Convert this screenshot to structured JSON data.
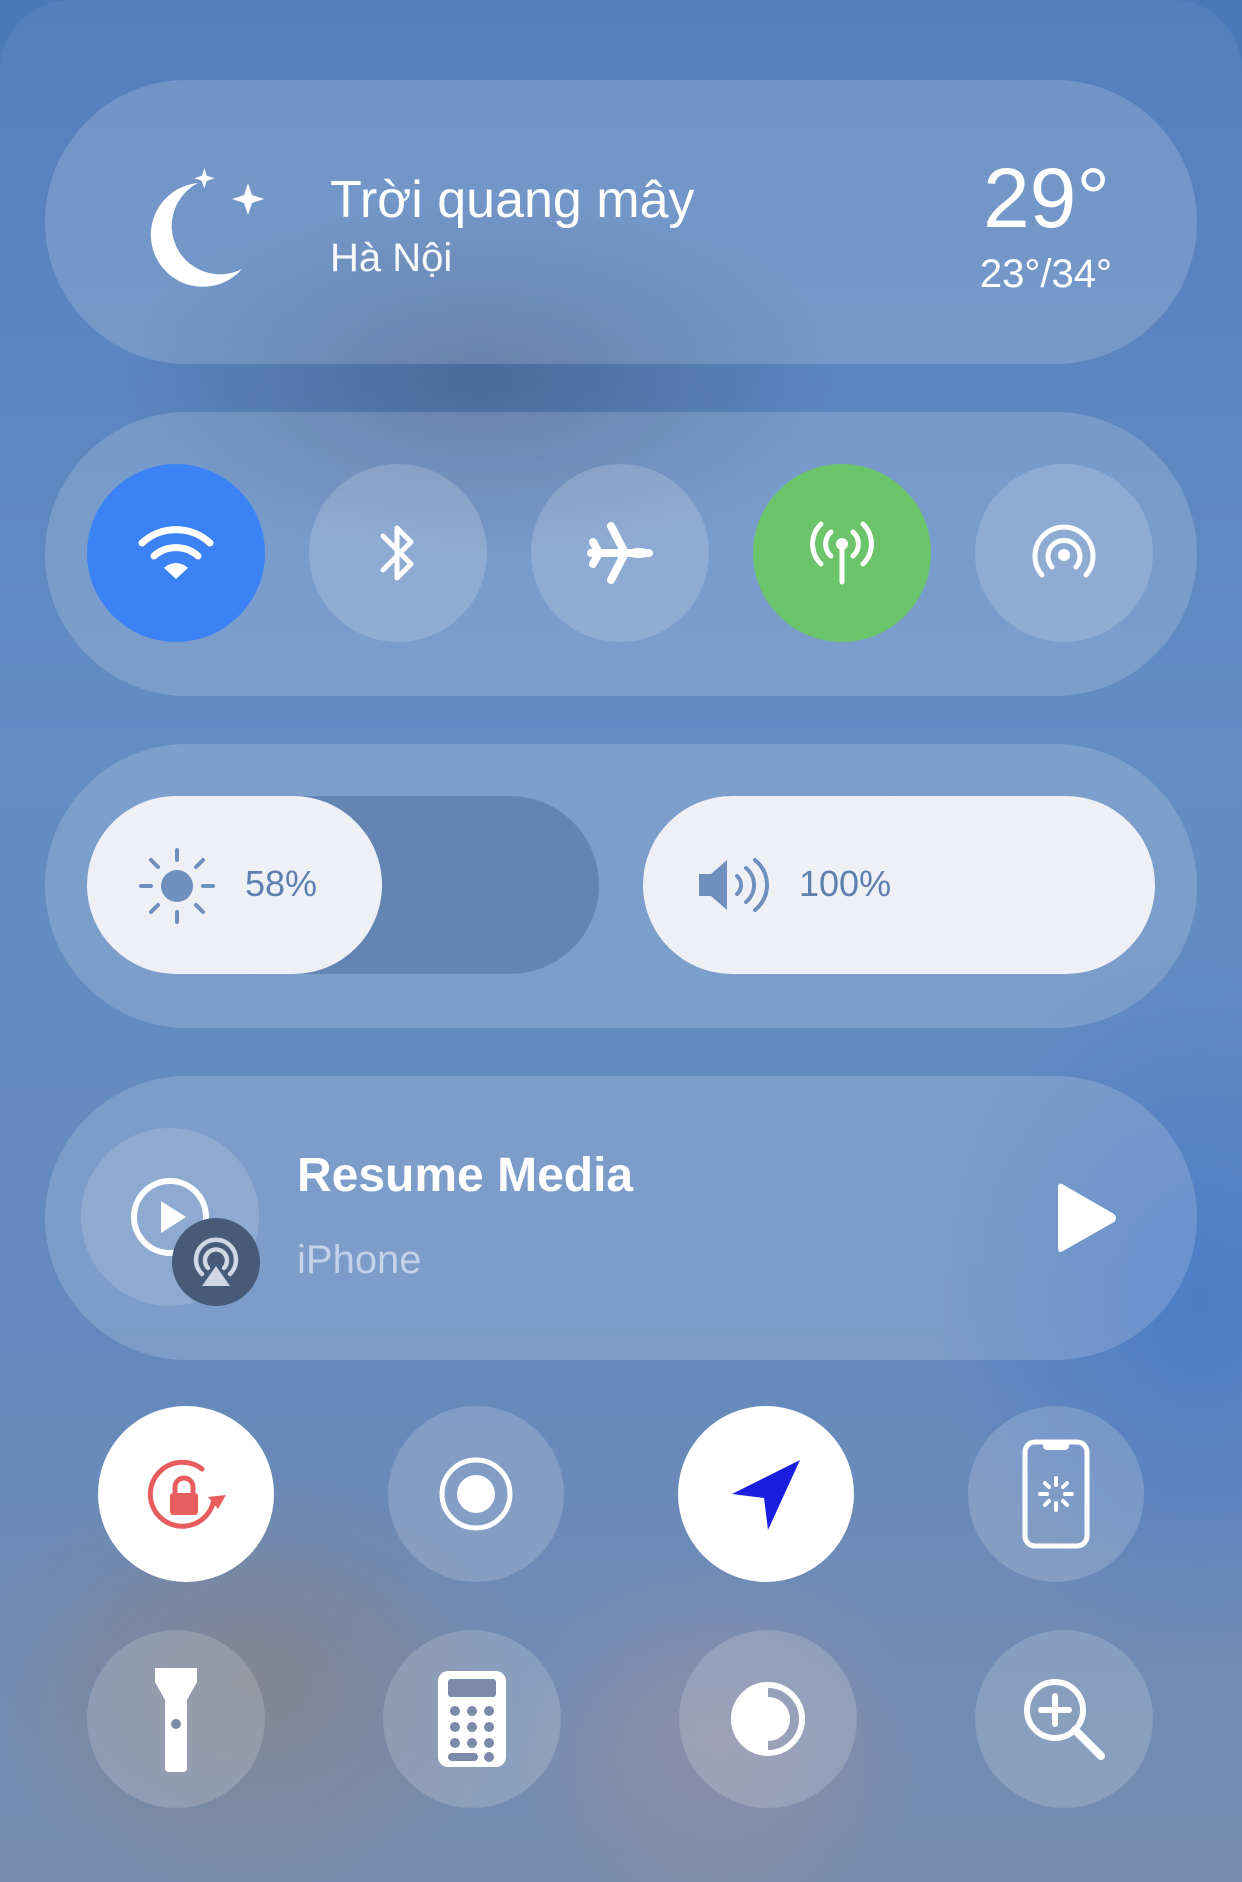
{
  "weather": {
    "condition": "Trời quang mây",
    "location": "Hà Nội",
    "temperature": "29°",
    "range": "23°/34°",
    "icon": "moon-stars-icon"
  },
  "connectivity": [
    {
      "name": "wifi",
      "icon": "wifi-icon",
      "active": true,
      "color": "#3b82f6"
    },
    {
      "name": "bluetooth",
      "icon": "bluetooth-icon",
      "active": false
    },
    {
      "name": "airplane-mode",
      "icon": "airplane-icon",
      "active": false
    },
    {
      "name": "cellular-data",
      "icon": "cellular-antenna-icon",
      "active": true,
      "color": "#6cc46a"
    },
    {
      "name": "airdrop",
      "icon": "airdrop-icon",
      "active": false
    }
  ],
  "brightness": {
    "label": "58%",
    "level": 0.58
  },
  "volume": {
    "label": "100%",
    "level": 1.0
  },
  "media": {
    "title": "Resume Media",
    "device": "iPhone"
  },
  "controls_row1": [
    {
      "name": "orientation-lock",
      "icon": "rotation-lock-icon",
      "active": true,
      "color": "#e85d5d"
    },
    {
      "name": "screen-record",
      "icon": "record-icon",
      "active": false
    },
    {
      "name": "location",
      "icon": "location-arrow-icon",
      "active": true,
      "color": "#1a1ee0"
    },
    {
      "name": "screen-mirroring",
      "icon": "phone-loading-icon",
      "active": false
    }
  ],
  "controls_row2": [
    {
      "name": "flashlight",
      "icon": "flashlight-icon"
    },
    {
      "name": "calculator",
      "icon": "calculator-icon"
    },
    {
      "name": "dark-mode",
      "icon": "contrast-icon"
    },
    {
      "name": "magnifier",
      "icon": "magnifier-icon"
    }
  ]
}
